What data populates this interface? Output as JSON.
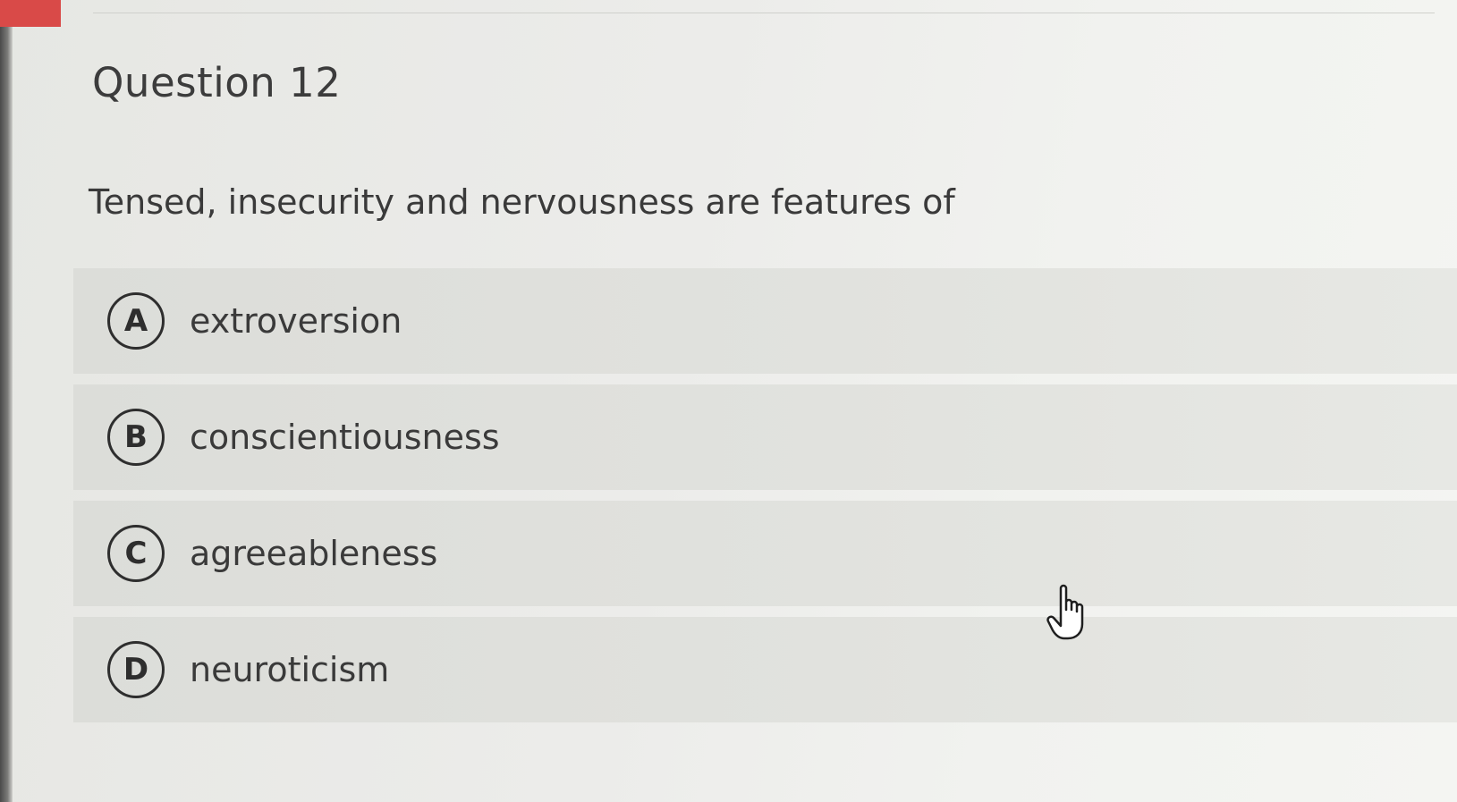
{
  "question": {
    "title": "Question 12",
    "prompt": "Tensed, insecurity and nervousness are features of"
  },
  "options": [
    {
      "letter": "A",
      "label": "extroversion"
    },
    {
      "letter": "B",
      "label": "conscientiousness"
    },
    {
      "letter": "C",
      "label": "agreeableness"
    },
    {
      "letter": "D",
      "label": "neuroticism"
    }
  ],
  "colors": {
    "accent": "#d94a48",
    "option_background": "#dcddd9",
    "text": "#3a3a3a"
  },
  "cursor": {
    "icon": "hand-pointer-icon"
  }
}
